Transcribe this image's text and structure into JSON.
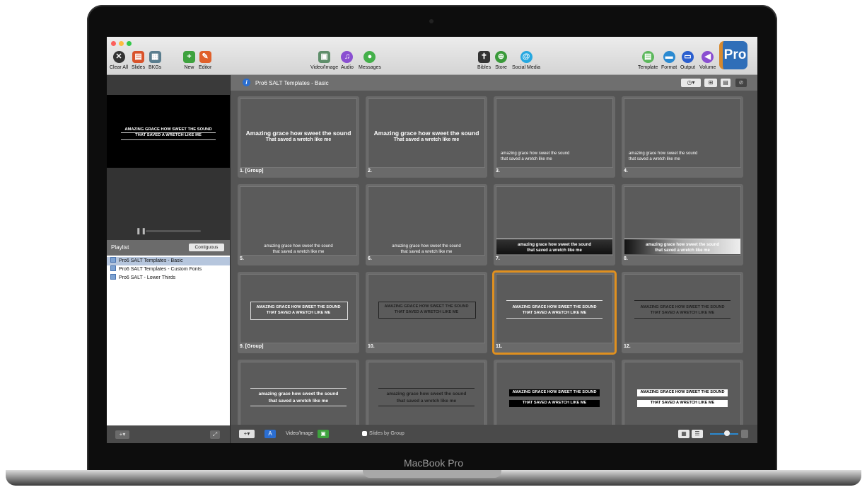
{
  "laptop": {
    "model": "MacBook Pro"
  },
  "toolbar": {
    "clear_all": "Clear All",
    "slides": "Slides",
    "bkgs": "BKGs",
    "new": "New",
    "editor": "Editor",
    "video_image": "Video/Image",
    "audio": "Audio",
    "messages": "Messages",
    "bibles": "Bibles",
    "store": "Store",
    "social_media": "Social Media",
    "template": "Template",
    "format": "Format",
    "output": "Output",
    "volume": "Volume",
    "logo": "Pro"
  },
  "preview": {
    "line1": "AMAZING GRACE HOW SWEET THE SOUND",
    "line2": "THAT SAVED A WRETCH LIKE ME"
  },
  "playlist": {
    "title": "Playlist",
    "mode_button": "Contiguous",
    "items": [
      "Pro6 SALT Templates - Basic",
      "Pro6 SALT Templates - Custom Fonts",
      "Pro6 SALT - Lower Thirds"
    ]
  },
  "main": {
    "title": "Pro6 SALT Templates - Basic"
  },
  "slides": [
    {
      "label": "1. [Group]",
      "l1": "Amazing grace how sweet the sound",
      "l2": "That saved a wretch like me"
    },
    {
      "label": "2.",
      "l1": "Amazing grace how sweet the sound",
      "l2": "That saved a wretch like me"
    },
    {
      "label": "3.",
      "l1": "amazing grace how sweet the sound",
      "l2": "that saved a wretch like me"
    },
    {
      "label": "4.",
      "l1": "amazing grace how sweet the sound",
      "l2": "that saved a wretch like me"
    },
    {
      "label": "5.",
      "l1": "amazing grace how sweet the sound",
      "l2": "that saved a wretch like me"
    },
    {
      "label": "6.",
      "l1": "amazing grace how sweet the sound",
      "l2": "that saved a wretch like me"
    },
    {
      "label": "7.",
      "l1": "amazing grace how sweet the sound",
      "l2": "that saved a wretch like me"
    },
    {
      "label": "8.",
      "l1": "amazing grace how sweet the sound",
      "l2": "that saved a wretch like me"
    },
    {
      "label": "9. [Group]",
      "l1": "AMAZING GRACE HOW SWEET THE SOUND",
      "l2": "THAT SAVED A WRETCH LIKE ME"
    },
    {
      "label": "10.",
      "l1": "AMAZING GRACE HOW SWEET THE SOUND",
      "l2": "THAT SAVED A WRETCH LIKE ME"
    },
    {
      "label": "11.",
      "l1": "AMAZING GRACE HOW SWEET THE SOUND",
      "l2": "THAT SAVED A WRETCH LIKE ME"
    },
    {
      "label": "12.",
      "l1": "AMAZING GRACE HOW SWEET THE SOUND",
      "l2": "THAT SAVED A WRETCH LIKE ME"
    },
    {
      "label": "",
      "l1": "amazing grace how sweet the sound",
      "l2": "that saved a wretch like me"
    },
    {
      "label": "",
      "l1": "amazing grace how sweet the sound",
      "l2": "that saved a wretch like me"
    },
    {
      "label": "",
      "l1": "AMAZING GRACE HOW SWEET THE SOUND",
      "l2": "THAT SAVED A WRETCH LIKE ME"
    },
    {
      "label": "",
      "l1": "AMAZING GRACE HOW SWEET THE SOUND",
      "l2": "THAT SAVED A WRETCH LIKE ME"
    }
  ],
  "footer": {
    "video_image": "Video/Image",
    "slides_by_group": "Slides by Group"
  },
  "colors": {
    "selection": "#e0901f",
    "accent_blue": "#2f6eb8"
  }
}
